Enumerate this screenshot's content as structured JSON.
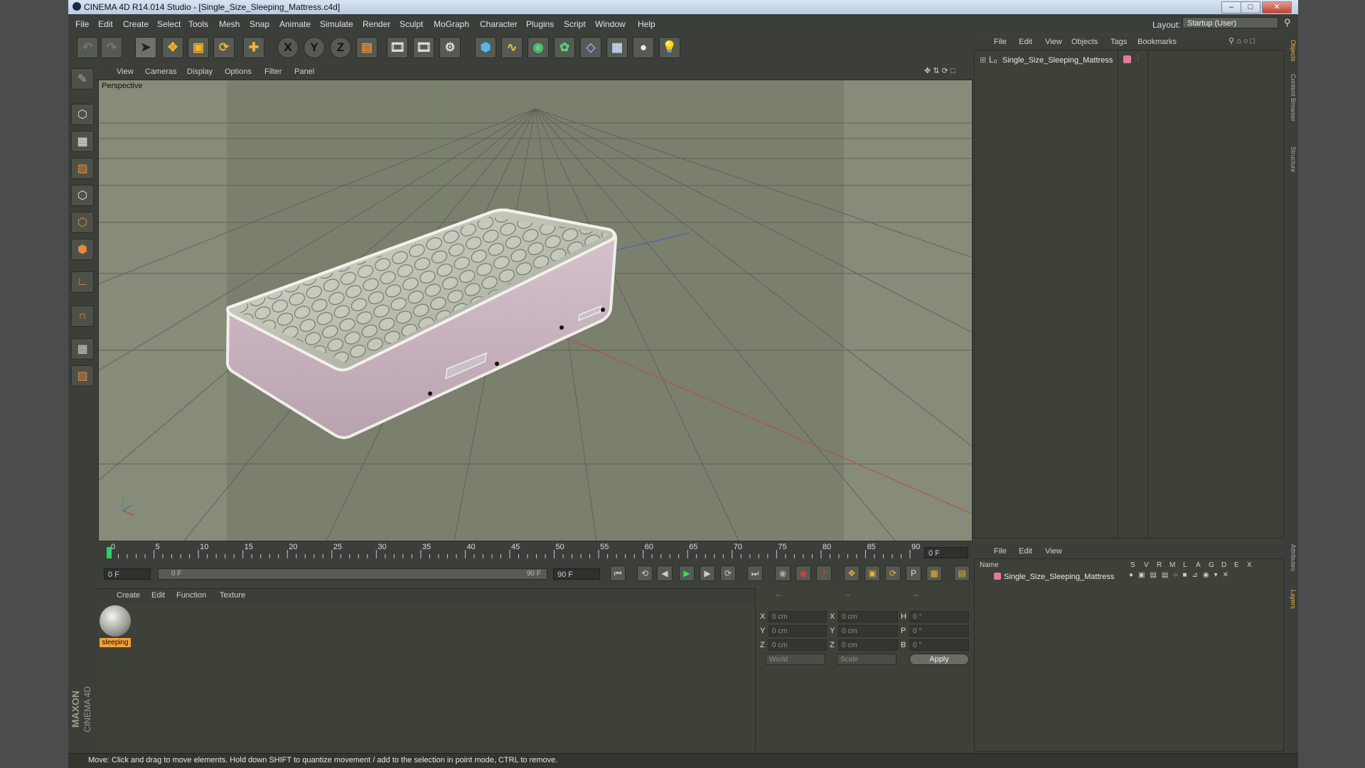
{
  "window": {
    "title": "CINEMA 4D R14.014 Studio - [Single_Size_Sleeping_Mattress.c4d]",
    "controls": [
      "–",
      "□",
      "✕"
    ]
  },
  "menubar": [
    "File",
    "Edit",
    "Create",
    "Select",
    "Tools",
    "Mesh",
    "Snap",
    "Animate",
    "Simulate",
    "Render",
    "Sculpt",
    "MoGraph",
    "Character",
    "Plugins",
    "Script",
    "Window",
    "Help"
  ],
  "layout": {
    "label": "Layout:",
    "value": "Startup (User)"
  },
  "toolbar_icons": [
    "undo-icon",
    "redo-icon",
    "select-arrow-icon",
    "move-icon",
    "scale-icon",
    "rotate-icon",
    "add-icon",
    "x-axis-icon",
    "y-axis-icon",
    "z-axis-icon",
    "coordinate-system-icon",
    "render-view-icon",
    "render-region-icon",
    "render-settings-icon",
    "cube-icon",
    "spline-icon",
    "nurbs-icon",
    "array-icon",
    "deformer-icon",
    "floor-icon",
    "camera-icon",
    "light-icon"
  ],
  "axis_labels": [
    "X",
    "Y",
    "Z"
  ],
  "left_tools": [
    "make-editable-icon",
    "model-mode-icon",
    "texture-mode-icon",
    "workplane-icon",
    "points-mode-icon",
    "edges-mode-icon",
    "polygons-mode-icon",
    "axis-mode-icon",
    "magnet-icon",
    "snap-icon",
    "locked-workplane-icon"
  ],
  "viewport": {
    "menu": [
      "View",
      "Cameras",
      "Display",
      "Options",
      "Filter",
      "Panel"
    ],
    "label": "Perspective"
  },
  "timeline": {
    "ticks": [
      "0",
      "5",
      "10",
      "15",
      "20",
      "25",
      "30",
      "35",
      "40",
      "45",
      "50",
      "55",
      "60",
      "65",
      "70",
      "75",
      "80",
      "85",
      "90"
    ],
    "current_frame": "0 F",
    "start_frame": "0 F",
    "range_start": "0 F",
    "range_end": "90 F",
    "end_frame": "90 F"
  },
  "material_manager": {
    "menu": [
      "Create",
      "Edit",
      "Function",
      "Texture"
    ],
    "material_name": "sleeping"
  },
  "coordinates": {
    "headers": [
      "--",
      "--",
      "--"
    ],
    "rows": [
      {
        "a": "X",
        "av": "0 cm",
        "b": "X",
        "bv": "0 cm",
        "c": "H",
        "cv": "0 °"
      },
      {
        "a": "Y",
        "av": "0 cm",
        "b": "Y",
        "bv": "0 cm",
        "c": "P",
        "cv": "0 °"
      },
      {
        "a": "Z",
        "av": "0 cm",
        "b": "Z",
        "bv": "0 cm",
        "c": "B",
        "cv": "0 °"
      }
    ],
    "world": "World",
    "scale": "Scale",
    "apply": "Apply"
  },
  "object_manager": {
    "menu": [
      "File",
      "Edit",
      "View",
      "Objects",
      "Tags",
      "Bookmarks"
    ],
    "object_name": "Single_Size_Sleeping_Mattress",
    "tag_color": "#e07aa0"
  },
  "layer_manager": {
    "menu": [
      "File",
      "Edit",
      "View"
    ],
    "columns": [
      "Name",
      "S",
      "V",
      "R",
      "M",
      "L",
      "A",
      "G",
      "D",
      "E",
      "X"
    ],
    "layer_name": "Single_Size_Sleeping_Mattress"
  },
  "right_tabs": [
    "Objects",
    "Content Browser",
    "Structure",
    "Attributes",
    "Layers"
  ],
  "status": "Move: Click and drag to move elements. Hold down SHIFT to quantize movement / add to the selection in point mode, CTRL to remove.",
  "brand": [
    "MAXON",
    "CINEMA 4D"
  ]
}
